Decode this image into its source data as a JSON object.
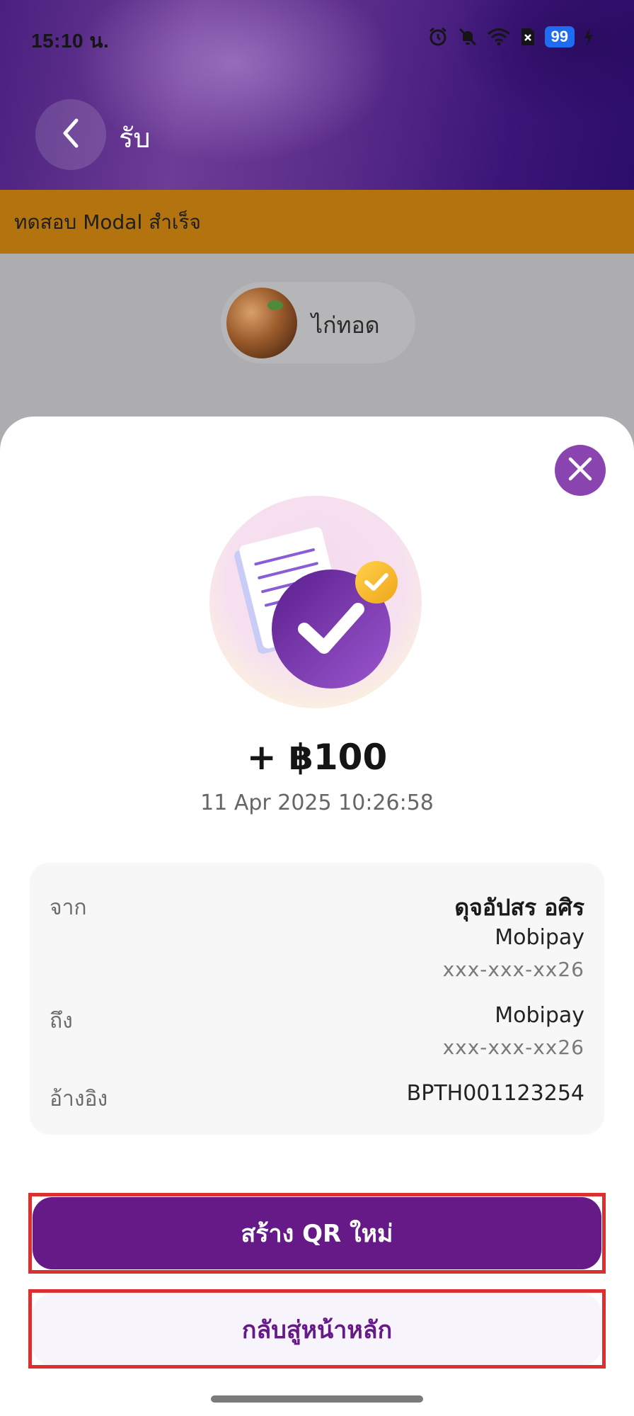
{
  "status_bar": {
    "time": "15:10 น.",
    "battery": "99",
    "icons": [
      "alarm-icon",
      "bell-off-icon",
      "wifi-icon",
      "sim-x-icon",
      "battery-icon",
      "charging-bolt-icon"
    ]
  },
  "header": {
    "title": "รับ",
    "back_icon": "chevron-left-icon"
  },
  "banner": {
    "text": "ทดสอบ Modal สำเร็จ",
    "color": "#b3730e"
  },
  "background_chip": {
    "label": "ไก่ทอด"
  },
  "receipt": {
    "amount": "+ ฿100",
    "datetime": "11 Apr 2025 10:26:58",
    "from_label": "จาก",
    "from_name": "ดุจอัปสร อศิร",
    "from_bank": "Mobipay",
    "from_account": "xxx-xxx-xx26",
    "to_label": "ถึง",
    "to_bank": "Mobipay",
    "to_account": "xxx-xxx-xx26",
    "ref_label": "อ้างอิง",
    "ref_value": "BPTH001123254"
  },
  "actions": {
    "primary_label": "สร้าง QR ใหม่",
    "secondary_label": "กลับสู่หน้าหลัก"
  },
  "colors": {
    "brand_purple": "#651a88",
    "close_button": "#8a44b0",
    "highlight_box": "#dc2f2f"
  }
}
